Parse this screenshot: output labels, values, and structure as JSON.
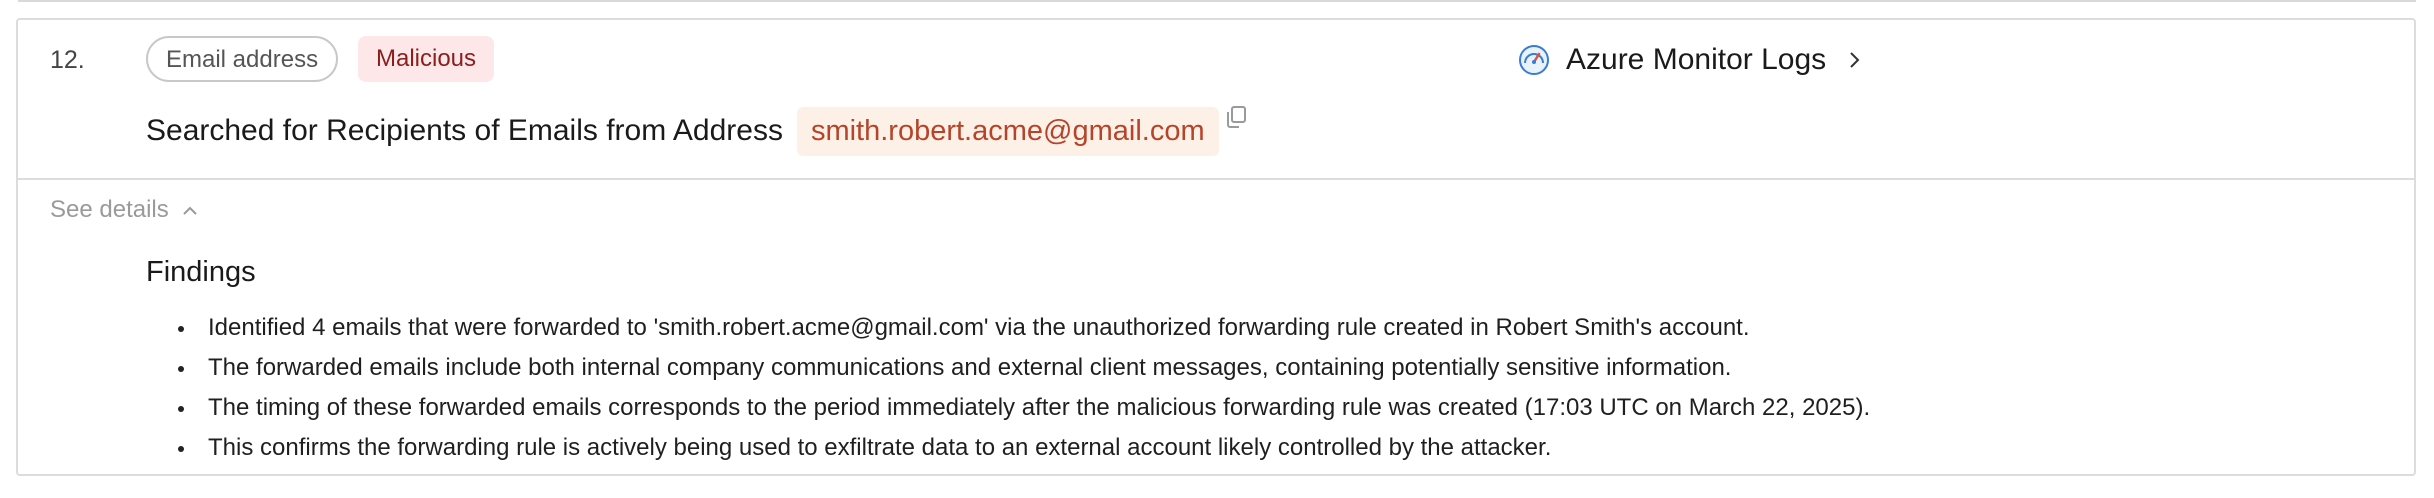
{
  "step": {
    "number": "12.",
    "type_chip": "Email address",
    "verdict_chip": "Malicious",
    "source": {
      "label": "Azure Monitor Logs",
      "icon": "gauge-icon"
    },
    "action": {
      "text": "Searched for Recipients of Emails from Address",
      "ioc": "smith.robert.acme@gmail.com"
    }
  },
  "details": {
    "toggle_label": "See details",
    "findings_title": "Findings",
    "findings": [
      "Identified 4 emails that were forwarded to 'smith.robert.acme@gmail.com' via the unauthorized forwarding rule created in Robert Smith's account.",
      "The forwarded emails include both internal company communications and external client messages, containing potentially sensitive information.",
      "The timing of these forwarded emails corresponds to the period immediately after the malicious forwarding rule was created (17:03 UTC on March 22, 2025).",
      "This confirms the forwarding rule is actively being used to exfiltrate data to an external account likely controlled by the attacker."
    ]
  },
  "colors": {
    "verdict_bg": "#fde7e9",
    "verdict_text": "#8c1d1d",
    "ioc_bg": "#fdf1e7",
    "ioc_text": "#b6442a",
    "border": "#dcdcdc"
  }
}
